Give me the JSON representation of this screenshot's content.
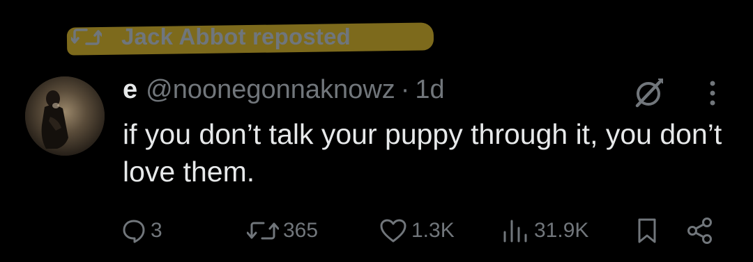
{
  "repost": {
    "icon": "repost-icon",
    "text": "Jack Abbot reposted",
    "highlight_color": "#7d6a1c"
  },
  "author": {
    "display_name": "e",
    "handle": "@noonegonnaknowz",
    "separator": "·",
    "time": "1d",
    "avatar": "avatar-image"
  },
  "post": {
    "text": "if you don’t talk your puppy through it, you don’t love them."
  },
  "actions": {
    "replies": "3",
    "reposts": "365",
    "likes": "1.3K",
    "views": "31.9K"
  },
  "icons": {
    "header": [
      "grok-icon",
      "more-icon"
    ],
    "action_bar": [
      "reply-icon",
      "repost-icon",
      "like-icon",
      "views-icon",
      "bookmark-icon",
      "share-icon"
    ]
  },
  "colors": {
    "background": "#000000",
    "primary_text": "#e7e9ea",
    "secondary_text": "#71767b"
  }
}
